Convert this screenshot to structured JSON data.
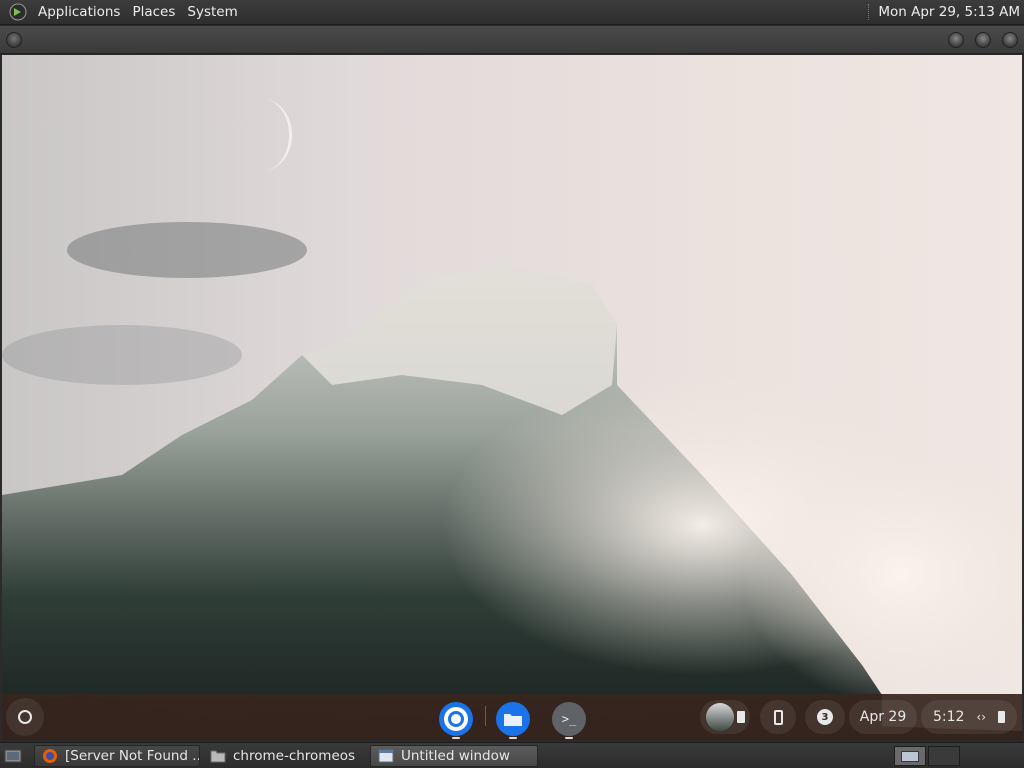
{
  "top_panel": {
    "menus": [
      "Applications",
      "Places",
      "System"
    ],
    "clock": "Mon Apr 29,  5:13 AM",
    "logo_icon": "gnome-foot-icon"
  },
  "shelf": {
    "apps": [
      {
        "name": "chrome",
        "icon": "chrome-icon",
        "color": "#1a73e8"
      },
      {
        "name": "files",
        "icon": "files-icon",
        "color": "#1a73e8"
      },
      {
        "name": "terminal",
        "icon": "terminal-icon",
        "color": "#5f6368"
      }
    ],
    "terminal_glyph": ">_",
    "notification_count": "3",
    "date": "Apr 29",
    "time": "5:12"
  },
  "taskbar": {
    "tasks": [
      {
        "label": "[Server Not Found ...",
        "icon": "firefox-icon",
        "active": false
      },
      {
        "label": "chrome-chromeos",
        "icon": "folder-icon",
        "active": false
      },
      {
        "label": "Untitled window",
        "icon": "window-icon",
        "active": true
      }
    ]
  }
}
